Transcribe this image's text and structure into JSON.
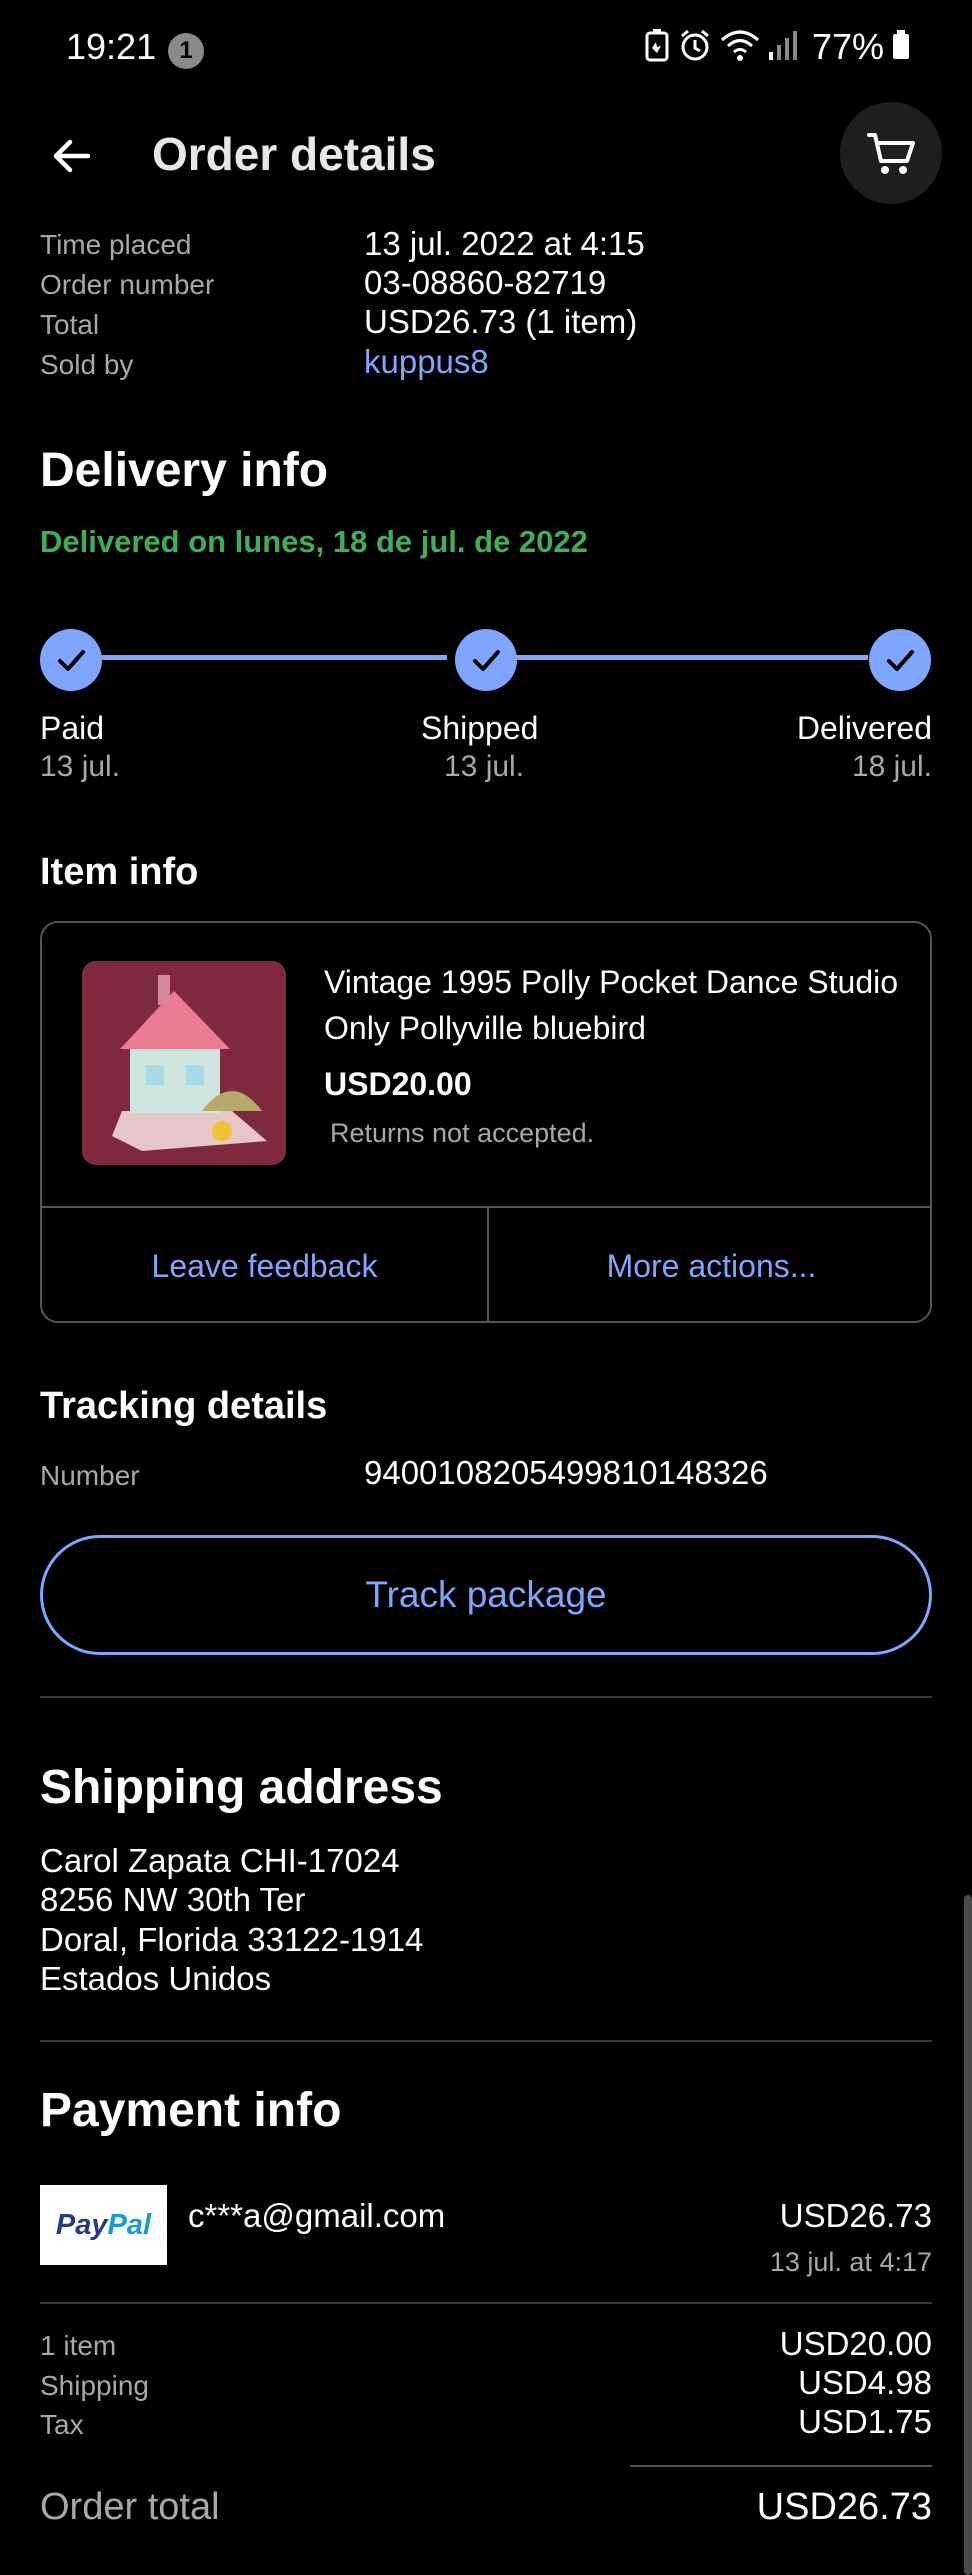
{
  "status_bar": {
    "time": "19:21",
    "notification_count": "1",
    "battery_percent": "77%",
    "icons": [
      "battery-saver-icon",
      "alarm-icon",
      "wifi-icon",
      "signal-icon",
      "battery-icon"
    ]
  },
  "header": {
    "title": "Order details",
    "back_icon": "arrow-left-icon",
    "cart_icon": "cart-icon"
  },
  "summary": {
    "time_placed_label": "Time placed",
    "time_placed_value": "13 jul. 2022 at 4:15",
    "order_number_label": "Order number",
    "order_number_value": "03-08860-82719",
    "total_label": "Total",
    "total_value": "USD26.73 (1 item)",
    "sold_by_label": "Sold by",
    "sold_by_value": "kuppus8"
  },
  "delivery": {
    "title": "Delivery info",
    "status": "Delivered on lunes, 18 de jul. de 2022",
    "status_color": "#3fae5a",
    "steps": [
      {
        "label": "Paid",
        "date": "13 jul."
      },
      {
        "label": "Shipped",
        "date": "13 jul."
      },
      {
        "label": "Delivered",
        "date": "18 jul."
      }
    ]
  },
  "item": {
    "section_title": "Item info",
    "title": "Vintage 1995 Polly Pocket Dance Studio Only Pollyville bluebird",
    "price": "USD20.00",
    "returns": "Returns not accepted.",
    "leave_feedback": "Leave feedback",
    "more_actions": "More actions..."
  },
  "tracking": {
    "title": "Tracking details",
    "number_label": "Number",
    "number_value": "9400108205499810148326",
    "track_button": "Track package"
  },
  "shipping": {
    "title": "Shipping address",
    "lines": [
      "Carol Zapata CHI-17024",
      "8256 NW 30th Ter",
      "Doral, Florida 33122-1914",
      "Estados Unidos"
    ]
  },
  "payment": {
    "title": "Payment info",
    "logo_text_a": "Pay",
    "logo_text_b": "Pal",
    "email": "c***a@gmail.com",
    "amount": "USD26.73",
    "date": "13 jul. at 4:17",
    "rows": [
      {
        "label": "1 item",
        "value": "USD20.00"
      },
      {
        "label": "Shipping",
        "value": "USD4.98"
      },
      {
        "label": "Tax",
        "value": "USD1.75"
      }
    ],
    "order_total_label": "Order total",
    "order_total_value": "USD26.73"
  },
  "colors": {
    "accent": "#7ea6ff",
    "delivered_green": "#3fae5a",
    "background": "#000000"
  }
}
